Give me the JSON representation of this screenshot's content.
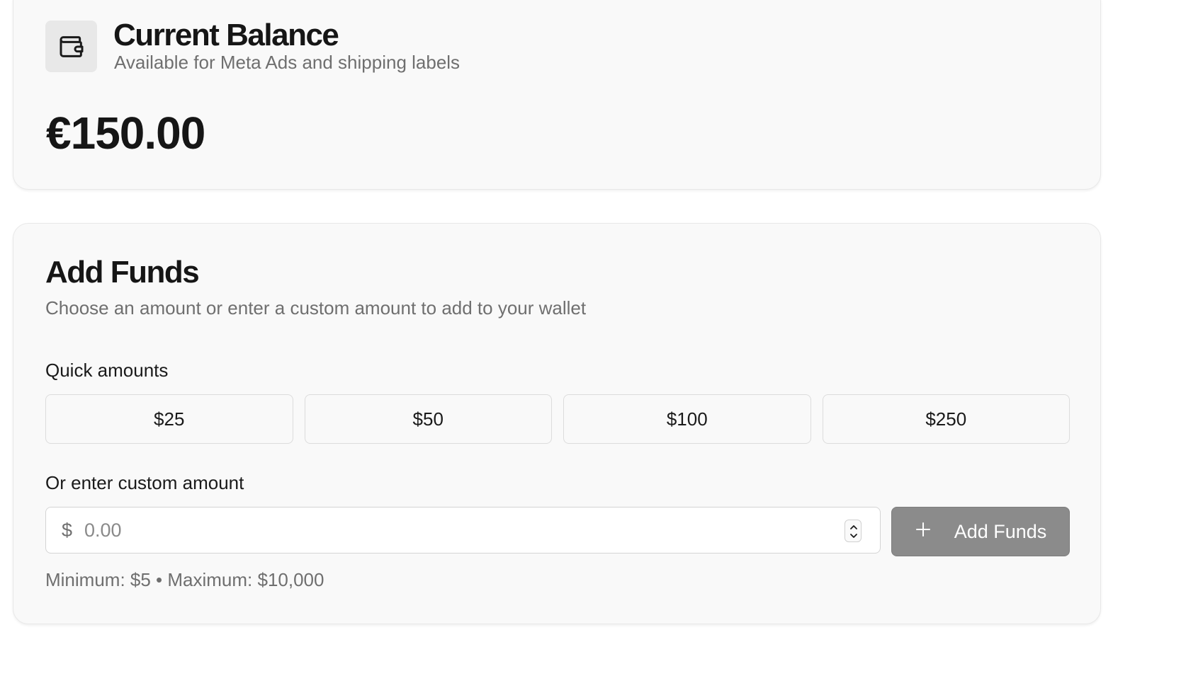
{
  "balance": {
    "title": "Current Balance",
    "subtitle": "Available for Meta Ads and shipping labels",
    "amount": "€150.00",
    "icon": "wallet-icon"
  },
  "add_funds": {
    "title": "Add Funds",
    "subtitle": "Choose an amount or enter a custom amount to add to your wallet",
    "quick_label": "Quick amounts",
    "quick_amounts": [
      "$25",
      "$50",
      "$100",
      "$250"
    ],
    "custom_label": "Or enter custom amount",
    "currency_symbol": "$",
    "input_placeholder": "0.00",
    "input_value": "",
    "submit_label": "Add Funds",
    "submit_icon": "plus-icon",
    "limits": "Minimum: $5 • Maximum: $10,000"
  },
  "colors": {
    "card_background": "#f9f9f9",
    "button_disabled": "#8b8b8b",
    "muted_text": "#6f6f6f"
  }
}
